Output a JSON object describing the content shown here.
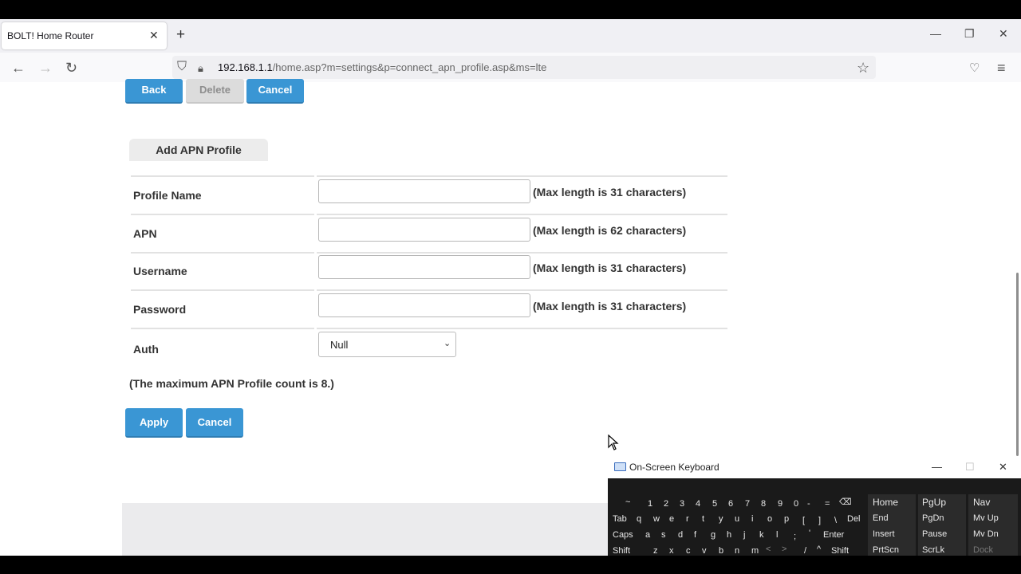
{
  "browser": {
    "tab_title": "BOLT! Home Router",
    "tab_close": "✕",
    "new_tab": "+",
    "url_host": "192.168.1.1",
    "url_path": "/home.asp?m=settings&p=connect_apn_profile.asp&ms=lte",
    "win_min": "—",
    "win_restore": "❐",
    "win_close": "✕",
    "icons": {
      "back": "←",
      "forward": "→",
      "reload": "↻",
      "shield": "⛉",
      "lock": "🔒︎",
      "star": "☆",
      "pocket": "♡",
      "menu": "≡"
    }
  },
  "top_buttons": {
    "back": "Back",
    "delete": "Delete",
    "cancel": "Cancel"
  },
  "section_title": "Add APN Profile",
  "fields": [
    {
      "label": "Profile Name",
      "value": "",
      "hint": "(Max length is 31 characters)"
    },
    {
      "label": "APN",
      "value": "",
      "hint": "(Max length is 62 characters)"
    },
    {
      "label": "Username",
      "value": "",
      "hint": "(Max length is 31 characters)"
    },
    {
      "label": "Password",
      "value": "",
      "hint": "(Max length is 31 characters)"
    }
  ],
  "auth": {
    "label": "Auth",
    "selected": "Null",
    "chevron": "⌄"
  },
  "max_note": "(The maximum APN Profile count is 8.)",
  "bottom_buttons": {
    "apply": "Apply",
    "cancel": "Cancel"
  },
  "osk": {
    "title": "On-Screen Keyboard",
    "win_min": "—",
    "win_max": "☐",
    "win_close": "✕",
    "rows": [
      [
        "~",
        "1",
        "2",
        "3",
        "4",
        "5",
        "6",
        "7",
        "8",
        "9",
        "0",
        "-",
        "=",
        "⌫"
      ],
      [
        "Tab",
        "q",
        "w",
        "e",
        "r",
        "t",
        "y",
        "u",
        "i",
        "o",
        "p",
        "[",
        "]",
        "\\",
        "Del"
      ],
      [
        "Caps",
        "a",
        "s",
        "d",
        "f",
        "g",
        "h",
        "j",
        "k",
        "l",
        ";",
        "'",
        "Enter"
      ],
      [
        "Shift",
        "z",
        "x",
        "c",
        "v",
        "b",
        "n",
        "m",
        "<",
        ">",
        "/",
        "^",
        "Shift"
      ]
    ],
    "side_keys": [
      [
        "Home",
        "PgUp",
        "Nav"
      ],
      [
        "End",
        "PgDn",
        "Mv Up"
      ],
      [
        "Insert",
        "Pause",
        "Mv Dn"
      ],
      [
        "PrtScn",
        "ScrLk",
        "Dock"
      ]
    ]
  }
}
